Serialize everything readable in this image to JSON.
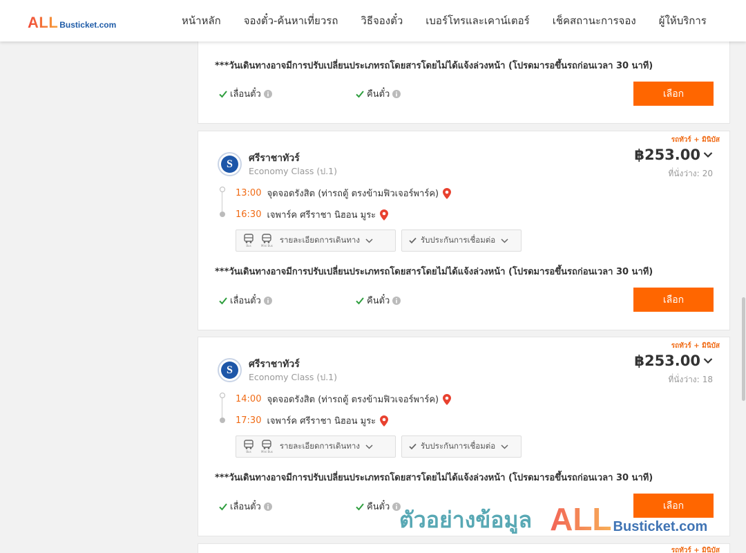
{
  "brand": {
    "logo_all": "ALL",
    "logo_rest": "Busticket.com"
  },
  "nav": [
    "หน้าหลัก",
    "จองตั๋ว-ค้นหาเที่ยวรถ",
    "วิธีจองตั๋ว",
    "เบอร์โทรและเคาน์เตอร์",
    "เช็คสถานะการจอง",
    "ผู้ให้บริการ"
  ],
  "top_card": {
    "notice": "***วันเดินทางอาจมีการปรับเปลี่ยนประเภทรถโดยสารโดยไม่ได้แจ้งล่วงหน้า (โปรดมารอขึ้นรถก่อนเวลา 30 นาที)",
    "feature_change": "เลื่อนตั๋ว",
    "feature_refund": "คืนตั๋ว",
    "select_label": "เลือก"
  },
  "trips": [
    {
      "tag": "รถทัวร์ + มินิบัส",
      "operator": "ศรีราชาทัวร์",
      "class": "Economy Class (ป.1)",
      "price": "฿253.00",
      "seats_label": "ที่นั่งว่าง:",
      "seats": "20",
      "dep_time": "13:00",
      "dep_place": "จุดจอดรังสิต (ท่ารถตู้ ตรงข้ามฟิวเจอร์พาร์ค)",
      "arr_time": "16:30",
      "arr_place": "เจพาร์ค ศรีราชา นิฮอน มูระ",
      "bus_caption": "Bus",
      "minibus_caption": "Mini Bus",
      "route_details": "รายละเอียดการเดินทาง",
      "insurance": "รับประกันการเชื่อมต่อ",
      "notice": "***วันเดินทางอาจมีการปรับเปลี่ยนประเภทรถโดยสารโดยไม่ได้แจ้งล่วงหน้า (โปรดมารอขึ้นรถก่อนเวลา 30 นาที)",
      "feature_change": "เลื่อนตั๋ว",
      "feature_refund": "คืนตั๋ว",
      "select_label": "เลือก"
    },
    {
      "tag": "รถทัวร์ + มินิบัส",
      "operator": "ศรีราชาทัวร์",
      "class": "Economy Class (ป.1)",
      "price": "฿253.00",
      "seats_label": "ที่นั่งว่าง:",
      "seats": "18",
      "dep_time": "14:00",
      "dep_place": "จุดจอดรังสิต (ท่ารถตู้ ตรงข้ามฟิวเจอร์พาร์ค)",
      "arr_time": "17:30",
      "arr_place": "เจพาร์ค ศรีราชา นิฮอน มูระ",
      "bus_caption": "Bus",
      "minibus_caption": "Mini Bus",
      "route_details": "รายละเอียดการเดินทาง",
      "insurance": "รับประกันการเชื่อมต่อ",
      "notice": "***วันเดินทางอาจมีการปรับเปลี่ยนประเภทรถโดยสารโดยไม่ได้แจ้งล่วงหน้า (โปรดมารอขึ้นรถก่อนเวลา 30 นาที)",
      "feature_change": "เลื่อนตั๋ว",
      "feature_refund": "คืนตั๋ว",
      "select_label": "เลือก"
    }
  ],
  "peek_card": {
    "tag": "รถทัวร์ + มินิบัส"
  },
  "watermark": {
    "text": "ตัวอย่างข้อมูล",
    "all": "ALL",
    "rest": "Busticket.com"
  },
  "colors": {
    "accent": "#ff6600",
    "time": "#f06a14",
    "check": "#2e9e3e",
    "pin": "#e8412f",
    "brand_blue": "#1f5ca8"
  }
}
